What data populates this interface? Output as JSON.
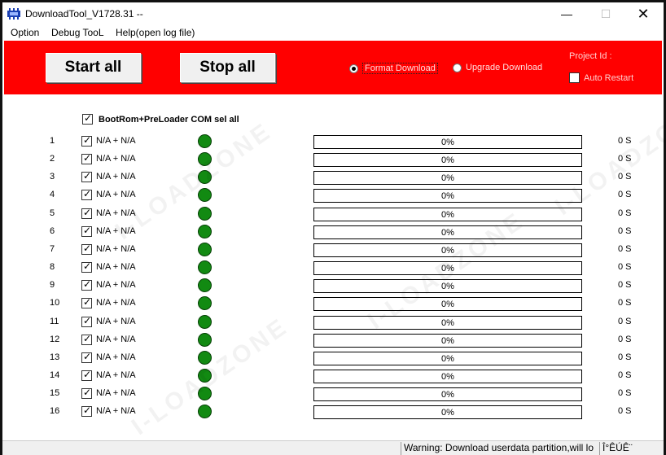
{
  "window": {
    "title": "DownloadTool_V1728.31 --",
    "min_symbol": "—",
    "max_symbol": "☐",
    "close_symbol": "✕"
  },
  "menu": {
    "items": [
      {
        "label": "Option"
      },
      {
        "label": "Debug TooL"
      },
      {
        "label": "Help(open log file)"
      }
    ]
  },
  "toolbar": {
    "start_label": "Start all",
    "stop_label": "Stop all",
    "format_download_label": "Format Download",
    "upgrade_download_label": "Upgrade Download",
    "format_download_selected": true,
    "project_id_label": "Project Id :",
    "auto_restart_label": "Auto Restart",
    "auto_restart_checked": false,
    "background_color": "#ff0000"
  },
  "list": {
    "select_all_label": "BootRom+PreLoader COM sel all",
    "select_all_checked": true,
    "rows": [
      {
        "index": "1",
        "port": "N/A + N/A",
        "progress": "0%",
        "time": "0 S",
        "checked": true
      },
      {
        "index": "2",
        "port": "N/A + N/A",
        "progress": "0%",
        "time": "0 S",
        "checked": true
      },
      {
        "index": "3",
        "port": "N/A + N/A",
        "progress": "0%",
        "time": "0 S",
        "checked": true
      },
      {
        "index": "4",
        "port": "N/A + N/A",
        "progress": "0%",
        "time": "0 S",
        "checked": true
      },
      {
        "index": "5",
        "port": "N/A + N/A",
        "progress": "0%",
        "time": "0 S",
        "checked": true
      },
      {
        "index": "6",
        "port": "N/A + N/A",
        "progress": "0%",
        "time": "0 S",
        "checked": true
      },
      {
        "index": "7",
        "port": "N/A + N/A",
        "progress": "0%",
        "time": "0 S",
        "checked": true
      },
      {
        "index": "8",
        "port": "N/A + N/A",
        "progress": "0%",
        "time": "0 S",
        "checked": true
      },
      {
        "index": "9",
        "port": "N/A + N/A",
        "progress": "0%",
        "time": "0 S",
        "checked": true
      },
      {
        "index": "10",
        "port": "N/A + N/A",
        "progress": "0%",
        "time": "0 S",
        "checked": true
      },
      {
        "index": "11",
        "port": "N/A + N/A",
        "progress": "0%",
        "time": "0 S",
        "checked": true
      },
      {
        "index": "12",
        "port": "N/A + N/A",
        "progress": "0%",
        "time": "0 S",
        "checked": true
      },
      {
        "index": "13",
        "port": "N/A + N/A",
        "progress": "0%",
        "time": "0 S",
        "checked": true
      },
      {
        "index": "14",
        "port": "N/A + N/A",
        "progress": "0%",
        "time": "0 S",
        "checked": true
      },
      {
        "index": "15",
        "port": "N/A + N/A",
        "progress": "0%",
        "time": "0 S",
        "checked": true
      },
      {
        "index": "16",
        "port": "N/A + N/A",
        "progress": "0%",
        "time": "0 S",
        "checked": true
      }
    ],
    "status_led_color": "#128a12"
  },
  "statusbar": {
    "message": "Warning: Download userdata partition,will lo",
    "extra": "Î°ÊÚÊ¨"
  },
  "watermark": {
    "text": "I-LOADZONE"
  }
}
